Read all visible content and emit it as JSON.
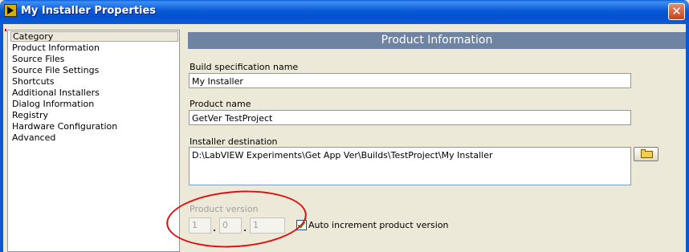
{
  "window": {
    "title": "My Installer Properties"
  },
  "category": {
    "header": "Category",
    "items": [
      {
        "label": "Product Information",
        "selected": true
      },
      {
        "label": "Source Files"
      },
      {
        "label": "Source File Settings"
      },
      {
        "label": "Shortcuts"
      },
      {
        "label": "Additional Installers"
      },
      {
        "label": "Dialog Information"
      },
      {
        "label": "Registry"
      },
      {
        "label": "Hardware Configuration"
      },
      {
        "label": "Advanced"
      }
    ]
  },
  "main": {
    "section_title": "Product Information",
    "build_spec": {
      "label": "Build specification name",
      "value": "My Installer"
    },
    "product_name": {
      "label": "Product name",
      "value": "GetVer TestProject"
    },
    "installer_destination": {
      "label": "Installer destination",
      "value": "D:\\LabVIEW Experiments\\Get App Ver\\Builds\\TestProject\\My Installer"
    },
    "product_version": {
      "label": "Product version",
      "major": "1",
      "minor": "0",
      "fix": "1",
      "separator": "."
    },
    "auto_increment": {
      "label": "Auto increment product version",
      "checked": true
    }
  },
  "colors": {
    "title_bar": "#0a58d6",
    "section_header": "#6f83a3",
    "selection": "#316ac5",
    "annotation": "#e01010"
  }
}
